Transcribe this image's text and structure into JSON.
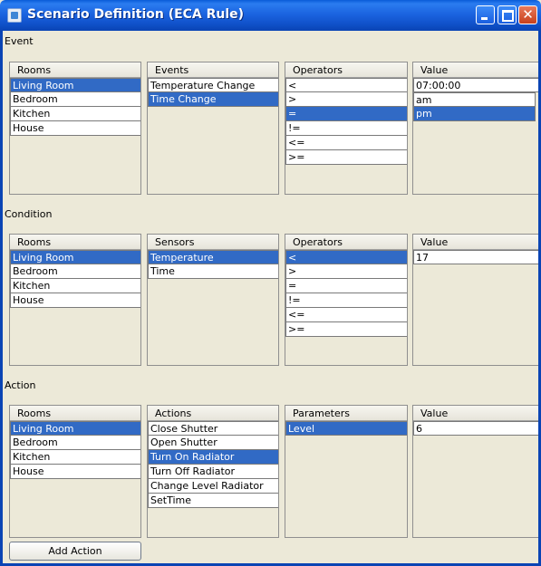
{
  "window": {
    "title": "Scenario Definition (ECA Rule)"
  },
  "event": {
    "label": "Event",
    "rooms": {
      "header": "Rooms",
      "items": [
        "Living Room",
        "Bedroom",
        "Kitchen",
        "House"
      ],
      "selected": 0
    },
    "events": {
      "header": "Events",
      "items": [
        "Temperature Change",
        "Time Change"
      ],
      "selected": 1
    },
    "operators": {
      "header": "Operators",
      "items": [
        "<",
        ">",
        "=",
        "!=",
        "<=",
        ">="
      ],
      "selected": 2
    },
    "value": {
      "header": "Value",
      "input": "07:00:00",
      "items": [
        "am",
        "pm"
      ],
      "selected": 1
    }
  },
  "condition": {
    "label": "Condition",
    "rooms": {
      "header": "Rooms",
      "items": [
        "Living Room",
        "Bedroom",
        "Kitchen",
        "House"
      ],
      "selected": 0
    },
    "sensors": {
      "header": "Sensors",
      "items": [
        "Temperature",
        "Time"
      ],
      "selected": 0
    },
    "operators": {
      "header": "Operators",
      "items": [
        "<",
        ">",
        "=",
        "!=",
        "<=",
        ">="
      ],
      "selected": 0
    },
    "value": {
      "header": "Value",
      "input": "17"
    }
  },
  "action": {
    "label": "Action",
    "rooms": {
      "header": "Rooms",
      "items": [
        "Living Room",
        "Bedroom",
        "Kitchen",
        "House"
      ],
      "selected": 0
    },
    "actions": {
      "header": "Actions",
      "items": [
        "Close Shutter",
        "Open Shutter",
        "Turn On Radiator",
        "Turn Off Radiator",
        "Change Level Radiator",
        "SetTime"
      ],
      "selected": 2
    },
    "parameters": {
      "header": "Parameters",
      "items": [
        "Level"
      ],
      "selected": 0
    },
    "value": {
      "header": "Value",
      "input": "6"
    }
  },
  "buttons": {
    "add_action": "Add Action"
  },
  "colors": {
    "selection": "#316ac5",
    "background": "#ece9d8",
    "titlebar": "#0a5cd8"
  },
  "icons": {
    "window": "java-cup-icon",
    "minimize": "minimize-icon",
    "maximize": "maximize-icon",
    "close": "close-icon"
  }
}
